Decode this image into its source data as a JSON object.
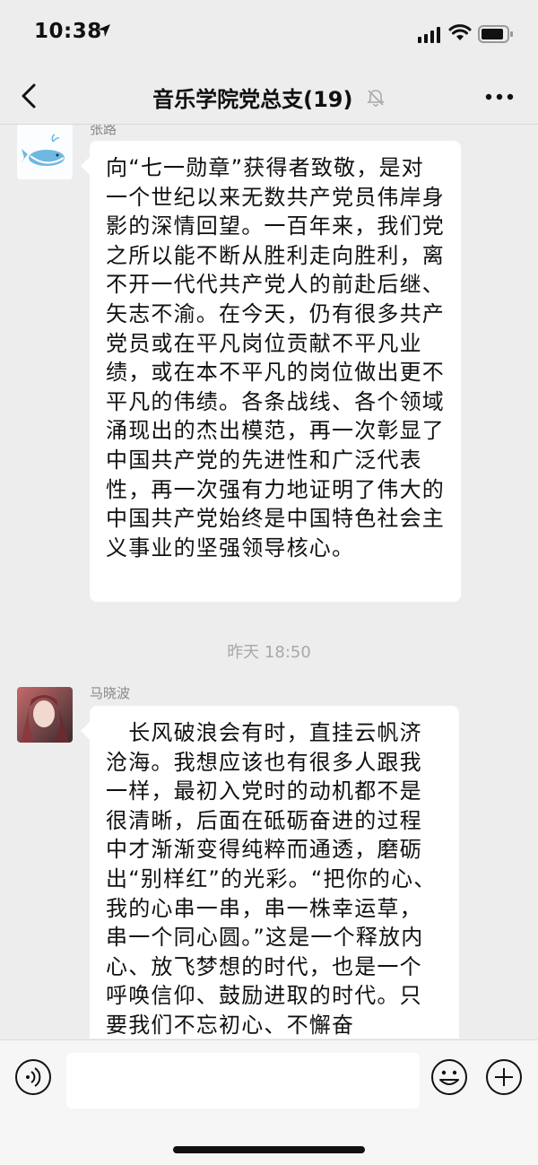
{
  "status_bar": {
    "time": "10:38"
  },
  "nav": {
    "title": "音乐学院党总支(19)"
  },
  "messages": [
    {
      "sender": "张路",
      "text": "向“七一勋章”获得者致敬，是对一个世纪以来无数共产党员伟岸身影的深情回望。一百年来，我们党之所以能不断从胜利走向胜利，离不开一代代共产党人的前赴后继、矢志不渝。在今天，仍有很多共产党员或在平凡岗位贡献不平凡业绩，或在本不平凡的岗位做出更不平凡的伟绩。各条战线、各个领域涌现出的杰出模范，再一次彰显了中国共产党的先进性和广泛代表性，再一次强有力地证明了伟大的中国共产党始终是中国特色社会主义事业的坚强领导核心。"
    },
    {
      "sender": "马晓波",
      "text": "　长风破浪会有时，直挂云帆济沧海。我想应该也有很多人跟我一样，最初入党时的动机都不是很清晰，后面在砥砺奋进的过程中才渐渐变得纯粹而通透，磨砺出“别样红”的光彩。“把你的心、我的心串一串，串一株幸运草，串一个同心圆。”这是一个释放内心、放飞梦想的时代，也是一个呼唤信仰、鼓励进取的时代。只要我们不忘初心、不懈奋"
    }
  ],
  "timestamp": "昨天 18:50",
  "input": {
    "value": "",
    "placeholder": ""
  },
  "icons": {
    "back": "chevron-left-icon",
    "mute": "bell-slash-icon",
    "more": "more-dots-icon",
    "voice": "voice-icon",
    "emoji": "emoji-icon",
    "plus": "plus-icon"
  },
  "colors": {
    "background": "#ededed",
    "bubble": "#ffffff",
    "meta_text": "#a8a8a8"
  }
}
